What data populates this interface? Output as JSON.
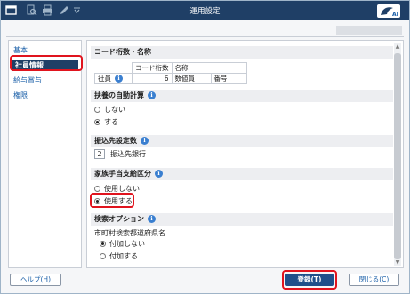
{
  "window": {
    "title": "運用設定"
  },
  "titlebar": {
    "icons": [
      "window-icon",
      "search-icon",
      "print-icon",
      "edit-icon",
      "chevron-down-icon"
    ],
    "logo": "ai-logo-icon"
  },
  "sidebar": {
    "items": [
      {
        "label": "基本"
      },
      {
        "label": "社員情報"
      },
      {
        "label": "給与賞与"
      },
      {
        "label": "権限"
      }
    ]
  },
  "sections": {
    "code": {
      "title": "コード桁数・名称",
      "headers": [
        "コード桁数",
        "名称"
      ],
      "row": {
        "label": "社員",
        "digits": "6",
        "name": "数値員",
        "name2": "番号"
      }
    },
    "dependent": {
      "title": "扶養の自動計算",
      "options": [
        "しない",
        "する"
      ],
      "selected": "する"
    },
    "bank": {
      "title": "振込先設定数",
      "value": "2",
      "suffix": "振込先銀行"
    },
    "family": {
      "title": "家族手当支給区分",
      "options": [
        "使用しない",
        "使用する"
      ],
      "selected": "使用する"
    },
    "search": {
      "title": "検索オプション",
      "sublabel": "市町村検索都道府県名",
      "options": [
        "付加しない",
        "付加する"
      ],
      "selected": "付加しない"
    }
  },
  "footer": {
    "help": "ヘルプ(H)",
    "register": "登録(T)",
    "close": "閉じる(C)"
  },
  "colors": {
    "titlebar": "#1f3f66",
    "highlight": "#e0141e",
    "accent": "#1a5fa8"
  }
}
